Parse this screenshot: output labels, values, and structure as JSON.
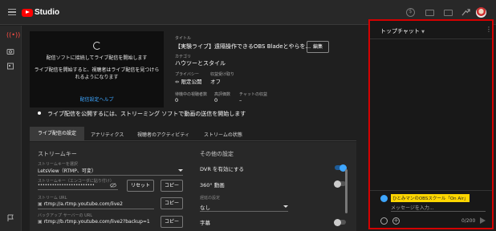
{
  "header": {
    "logo_text": "Studio",
    "icons": [
      "menu-icon",
      "dollar-icon",
      "captions-icon",
      "inbox-icon",
      "share-icon",
      "account-avatar"
    ]
  },
  "left_rail": {
    "items": [
      "live-icon",
      "camera-icon",
      "calendar-icon",
      "feedback-flag-icon"
    ]
  },
  "preview": {
    "line1": "配信ソフトに接続してライブ配信を開始します",
    "line2": "ライブ配信を開始すると、視聴者はライブ配信を見つけら",
    "line3": "れるようになります",
    "help_link": "配信設定ヘルプ"
  },
  "meta": {
    "title_label": "タイトル",
    "title_value": "【実験ライブ】遠隔操作できるOBS Bladeとやらを...",
    "category_label": "カテゴリ",
    "category_value": "ハウツーとスタイル",
    "privacy_label": "プライバシー",
    "privacy_value": "限定公開",
    "privacy_icon": "link-icon",
    "monetization_label": "収益受け取り",
    "monetization_value": "オフ",
    "waiting_label": "待機中の視聴者数",
    "waiting_value": "0",
    "likes_label": "高評価数",
    "likes_value": "0",
    "chat_revenue_label": "チャットの収益",
    "chat_revenue_value": "–",
    "edit_button": "編集"
  },
  "notice": "ライブ配信を公開するには、ストリーミング ソフトで動画の送信を開始します",
  "tabs": [
    {
      "label": "ライブ配信の設定",
      "active": true
    },
    {
      "label": "アナリティクス",
      "active": false
    },
    {
      "label": "視聴者のアクティビティ",
      "active": false
    },
    {
      "label": "ストリームの状態",
      "active": false
    }
  ],
  "stream_key": {
    "section_title": "ストリームキー",
    "select_label": "ストリームキーを選択",
    "select_value": "LetsView（RTMP、可変）",
    "key_label": "ストリームキー（エンコーダに貼り付け）",
    "key_value": "••••••••••••••••••••••••",
    "reset_button": "リセット",
    "copy_button": "コピー",
    "url_label": "ストリーム URL",
    "url_value": "rtmp://a.rtmp.youtube.com/live2",
    "backup_label": "バックアップ サーバーの URL",
    "backup_value": "rtmp://b.rtmp.youtube.com/live2?backup=1"
  },
  "other_settings": {
    "section_title": "その他の設定",
    "dvr_label": "DVR を有効にする",
    "dvr_on": true,
    "video360_label": "360° 動画",
    "video360_on": false,
    "latency_label": "遅延の設定",
    "latency_value": "なし",
    "captions_label": "字幕",
    "captions_on": false
  },
  "chat": {
    "title": "トップチャット",
    "more_icon": "more-vert-icon",
    "user_name": "ひとみマンのOBSスクール「On Air」",
    "placeholder": "メッセージを入力...",
    "count": "0/200",
    "accent_color": "#d30000"
  }
}
